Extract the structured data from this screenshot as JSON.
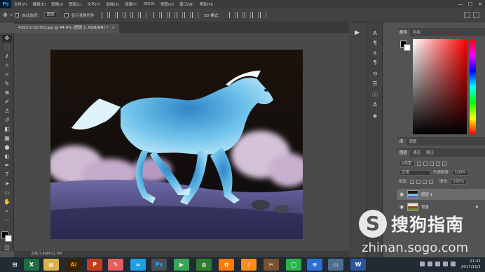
{
  "app": {
    "logo": "Ps"
  },
  "menu": [
    "文件(F)",
    "编辑(E)",
    "图像(I)",
    "图层(L)",
    "文字(Y)",
    "选择(S)",
    "滤镜(T)",
    "3D(D)",
    "视图(V)",
    "窗口(W)",
    "帮助(H)"
  ],
  "window_controls": [
    "—",
    "□",
    "✕"
  ],
  "options": {
    "auto_select_label": "自动选择：",
    "auto_select_value": "图层",
    "show_transform_label": "显示变换控件",
    "mode_3d_label": "3D 模式："
  },
  "document": {
    "tab_title": "4353-1-31H53.jpg @ 44.4% (图层 1, RGB/8#) *",
    "tab_close": "×",
    "status": "文档:3.49M/11.0M"
  },
  "color_panel": {
    "tabs": [
      "颜色",
      "色板"
    ],
    "foreground": "#000000",
    "background": "#ffffff"
  },
  "lib_panel": {
    "tabs": [
      "库",
      "调整"
    ]
  },
  "layers_panel": {
    "tabs": [
      "图层",
      "通道",
      "路径"
    ],
    "kind_filter": "ρ类型",
    "blend_mode": "正常",
    "opacity_label": "不透明度:",
    "opacity_value": "100%",
    "lock_label": "锁定:",
    "fill_label": "填充:",
    "fill_value": "100%",
    "layers": [
      {
        "name": "图层 1",
        "selected": true
      },
      {
        "name": "背景",
        "selected": false
      }
    ]
  },
  "watermark": {
    "logo_char": "S",
    "title": "搜狗指南",
    "url": "zhinan.sogo.com"
  },
  "taskbar": {
    "clock_time": "21:31",
    "clock_date": "2017/11/1"
  }
}
